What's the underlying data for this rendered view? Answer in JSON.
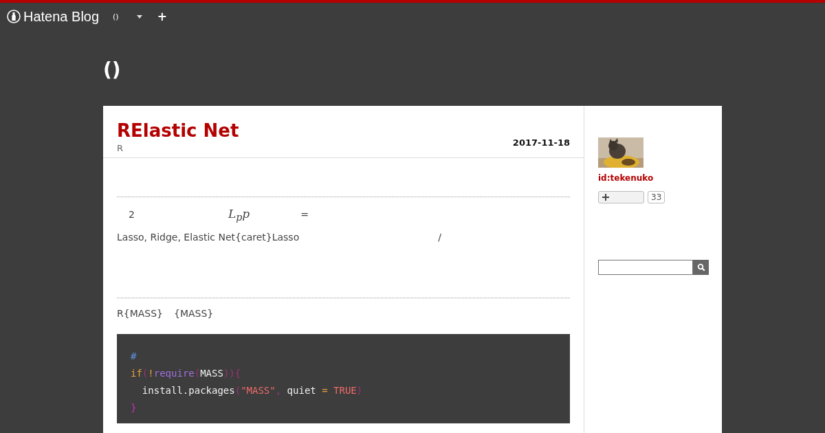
{
  "header": {
    "brand": "Hatena Blog",
    "blog_menu": "()",
    "add_label": "+"
  },
  "blog_title": "()",
  "article": {
    "title": "RElastic Net",
    "category": "R",
    "date": "2017-11-18",
    "paragraphs": [
      {
        "kind": "math",
        "parts": [
          "2",
          "L$_{p}$p",
          "="
        ]
      },
      {
        "kind": "text",
        "parts": [
          "Lasso, Ridge, Elastic Net{caret}Lasso",
          "/"
        ]
      },
      {
        "kind": "rule"
      },
      {
        "kind": "text",
        "parts": [
          "R{MASS}",
          "{MASS}"
        ]
      }
    ],
    "code": [
      [
        {
          "t": "#",
          "kind": "comment"
        }
      ],
      [
        {
          "t": "if",
          "kind": "keyword"
        },
        {
          "t": "(",
          "kind": "paren"
        },
        {
          "t": "!",
          "kind": "keyword"
        },
        {
          "t": "require",
          "kind": "func"
        },
        {
          "t": "(",
          "kind": "paren"
        },
        {
          "t": "MASS",
          "kind": "plain"
        },
        {
          "t": ")){",
          "kind": "paren"
        }
      ],
      [
        {
          "t": "  install.packages",
          "kind": "plain"
        },
        {
          "t": "(",
          "kind": "paren"
        },
        {
          "t": "\"MASS\"",
          "kind": "string"
        },
        {
          "t": ",",
          "kind": "paren"
        },
        {
          "t": " quiet ",
          "kind": "plain"
        },
        {
          "t": "=",
          "kind": "keyword"
        },
        {
          "t": " TRUE",
          "kind": "string"
        },
        {
          "t": ")",
          "kind": "paren"
        }
      ],
      [
        {
          "t": "}",
          "kind": "brace"
        }
      ]
    ]
  },
  "sidebar": {
    "user_id": "id:tekenuko",
    "subscribe_count": "33"
  }
}
